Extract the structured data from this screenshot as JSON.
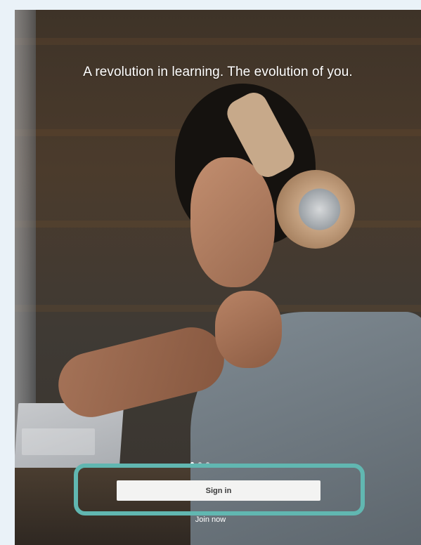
{
  "hero": {
    "tagline": "A revolution in learning. The evolution of you."
  },
  "carousel": {
    "page_count": 3,
    "active_index": 0
  },
  "actions": {
    "signin_label": "Sign in",
    "join_label": "Join now"
  },
  "colors": {
    "highlight": "#61b7b1",
    "button_bg": "#f3f3f2",
    "text_on_photo": "#ffffff"
  }
}
